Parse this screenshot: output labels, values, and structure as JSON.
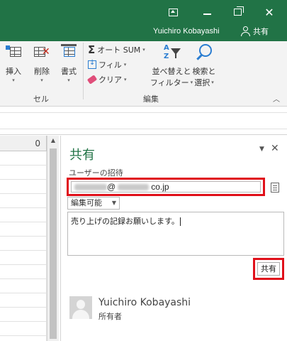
{
  "titlebar": {
    "user_name": "Yuichiro Kobayashi",
    "share_label": "共有",
    "accent_color": "#217346"
  },
  "ribbon": {
    "cells": {
      "insert_label": "挿入",
      "delete_label": "削除",
      "format_label": "書式",
      "group_label": "セル"
    },
    "editing": {
      "autosum_label": "オート SUM",
      "fill_label": "フィル",
      "clear_label": "クリア",
      "sort_filter_line1": "並べ替えと",
      "sort_filter_line2": "フィルター",
      "find_select_line1": "検索と",
      "find_select_line2": "選択",
      "group_label": "編集"
    }
  },
  "sheet": {
    "column_header": "0"
  },
  "share_pane": {
    "title": "共有",
    "invite_label": "ユーザーの招待",
    "invite_email_domain": "co.jp",
    "invite_email_at": "@",
    "permission_value": "編集可能",
    "message_text": "売り上げの記録お願いします。",
    "share_button_label": "共有",
    "owner": {
      "name": "Yuichiro Kobayashi",
      "role": "所有者"
    },
    "highlight_color": "#e0101a"
  }
}
